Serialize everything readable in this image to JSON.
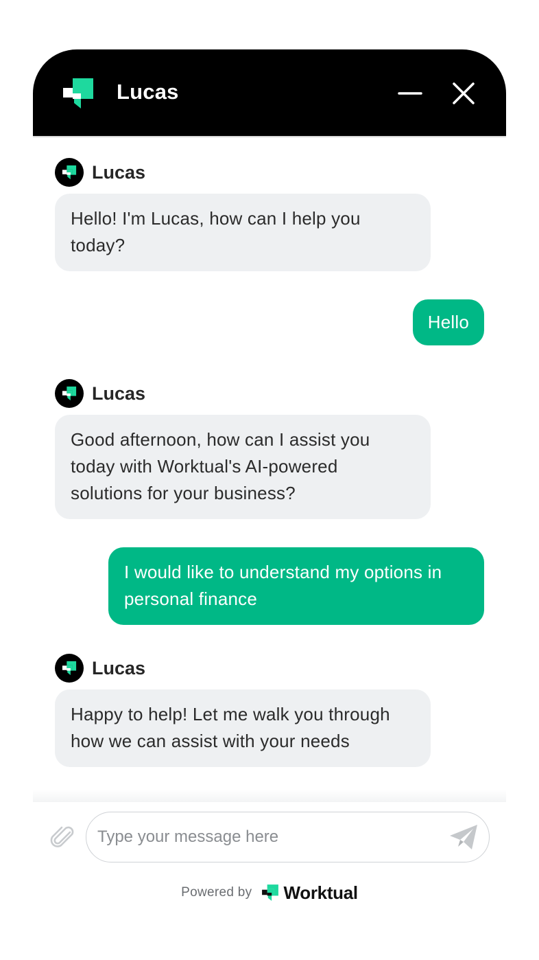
{
  "header": {
    "title": "Lucas",
    "logo_icon": "worktual-logo-icon",
    "minimize_icon": "minimize-icon",
    "close_icon": "close-icon"
  },
  "messages": [
    {
      "from": "bot",
      "name": "Lucas",
      "text": "Hello! I'm Lucas, how can I help you today?"
    },
    {
      "from": "user",
      "text": "Hello"
    },
    {
      "from": "bot",
      "name": "Lucas",
      "text": "Good afternoon, how can I assist you today with Worktual's AI-powered solutions for your business?"
    },
    {
      "from": "user",
      "text": "I would like to understand my options in personal finance"
    },
    {
      "from": "bot",
      "name": "Lucas",
      "text": "Happy to help! Let me walk you through how we can assist with your needs"
    }
  ],
  "composer": {
    "placeholder": "Type your message here",
    "value": "",
    "attach_icon": "paperclip-icon",
    "send_icon": "send-icon"
  },
  "footer": {
    "powered_by": "Powered by",
    "brand": "Worktual"
  },
  "colors": {
    "header_bg": "#000000",
    "accent": "#00b886",
    "bot_bubble": "#eef0f2",
    "logo_green": "#1ed99e"
  }
}
